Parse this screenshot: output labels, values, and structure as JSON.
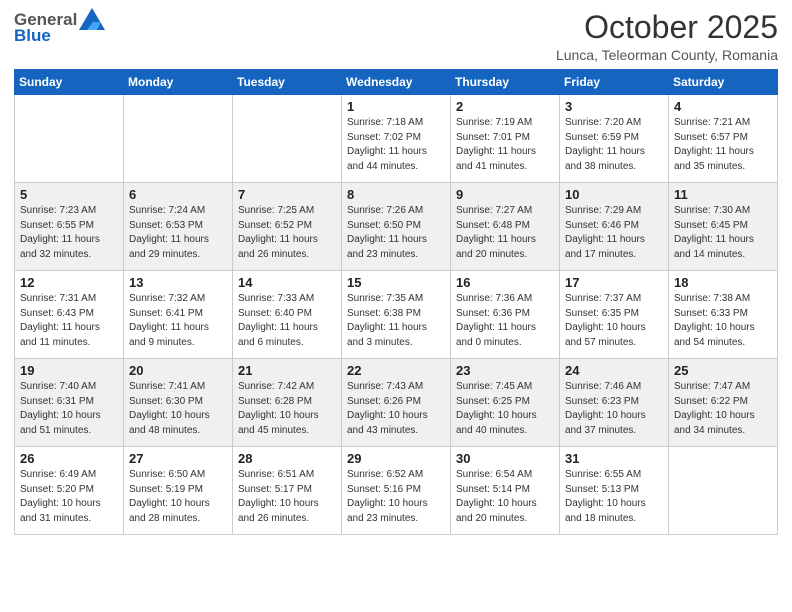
{
  "header": {
    "logo_general": "General",
    "logo_blue": "Blue",
    "month_title": "October 2025",
    "location": "Lunca, Teleorman County, Romania"
  },
  "days_of_week": [
    "Sunday",
    "Monday",
    "Tuesday",
    "Wednesday",
    "Thursday",
    "Friday",
    "Saturday"
  ],
  "weeks": [
    [
      {
        "day": "",
        "info": ""
      },
      {
        "day": "",
        "info": ""
      },
      {
        "day": "",
        "info": ""
      },
      {
        "day": "1",
        "info": "Sunrise: 7:18 AM\nSunset: 7:02 PM\nDaylight: 11 hours\nand 44 minutes."
      },
      {
        "day": "2",
        "info": "Sunrise: 7:19 AM\nSunset: 7:01 PM\nDaylight: 11 hours\nand 41 minutes."
      },
      {
        "day": "3",
        "info": "Sunrise: 7:20 AM\nSunset: 6:59 PM\nDaylight: 11 hours\nand 38 minutes."
      },
      {
        "day": "4",
        "info": "Sunrise: 7:21 AM\nSunset: 6:57 PM\nDaylight: 11 hours\nand 35 minutes."
      }
    ],
    [
      {
        "day": "5",
        "info": "Sunrise: 7:23 AM\nSunset: 6:55 PM\nDaylight: 11 hours\nand 32 minutes."
      },
      {
        "day": "6",
        "info": "Sunrise: 7:24 AM\nSunset: 6:53 PM\nDaylight: 11 hours\nand 29 minutes."
      },
      {
        "day": "7",
        "info": "Sunrise: 7:25 AM\nSunset: 6:52 PM\nDaylight: 11 hours\nand 26 minutes."
      },
      {
        "day": "8",
        "info": "Sunrise: 7:26 AM\nSunset: 6:50 PM\nDaylight: 11 hours\nand 23 minutes."
      },
      {
        "day": "9",
        "info": "Sunrise: 7:27 AM\nSunset: 6:48 PM\nDaylight: 11 hours\nand 20 minutes."
      },
      {
        "day": "10",
        "info": "Sunrise: 7:29 AM\nSunset: 6:46 PM\nDaylight: 11 hours\nand 17 minutes."
      },
      {
        "day": "11",
        "info": "Sunrise: 7:30 AM\nSunset: 6:45 PM\nDaylight: 11 hours\nand 14 minutes."
      }
    ],
    [
      {
        "day": "12",
        "info": "Sunrise: 7:31 AM\nSunset: 6:43 PM\nDaylight: 11 hours\nand 11 minutes."
      },
      {
        "day": "13",
        "info": "Sunrise: 7:32 AM\nSunset: 6:41 PM\nDaylight: 11 hours\nand 9 minutes."
      },
      {
        "day": "14",
        "info": "Sunrise: 7:33 AM\nSunset: 6:40 PM\nDaylight: 11 hours\nand 6 minutes."
      },
      {
        "day": "15",
        "info": "Sunrise: 7:35 AM\nSunset: 6:38 PM\nDaylight: 11 hours\nand 3 minutes."
      },
      {
        "day": "16",
        "info": "Sunrise: 7:36 AM\nSunset: 6:36 PM\nDaylight: 11 hours\nand 0 minutes."
      },
      {
        "day": "17",
        "info": "Sunrise: 7:37 AM\nSunset: 6:35 PM\nDaylight: 10 hours\nand 57 minutes."
      },
      {
        "day": "18",
        "info": "Sunrise: 7:38 AM\nSunset: 6:33 PM\nDaylight: 10 hours\nand 54 minutes."
      }
    ],
    [
      {
        "day": "19",
        "info": "Sunrise: 7:40 AM\nSunset: 6:31 PM\nDaylight: 10 hours\nand 51 minutes."
      },
      {
        "day": "20",
        "info": "Sunrise: 7:41 AM\nSunset: 6:30 PM\nDaylight: 10 hours\nand 48 minutes."
      },
      {
        "day": "21",
        "info": "Sunrise: 7:42 AM\nSunset: 6:28 PM\nDaylight: 10 hours\nand 45 minutes."
      },
      {
        "day": "22",
        "info": "Sunrise: 7:43 AM\nSunset: 6:26 PM\nDaylight: 10 hours\nand 43 minutes."
      },
      {
        "day": "23",
        "info": "Sunrise: 7:45 AM\nSunset: 6:25 PM\nDaylight: 10 hours\nand 40 minutes."
      },
      {
        "day": "24",
        "info": "Sunrise: 7:46 AM\nSunset: 6:23 PM\nDaylight: 10 hours\nand 37 minutes."
      },
      {
        "day": "25",
        "info": "Sunrise: 7:47 AM\nSunset: 6:22 PM\nDaylight: 10 hours\nand 34 minutes."
      }
    ],
    [
      {
        "day": "26",
        "info": "Sunrise: 6:49 AM\nSunset: 5:20 PM\nDaylight: 10 hours\nand 31 minutes."
      },
      {
        "day": "27",
        "info": "Sunrise: 6:50 AM\nSunset: 5:19 PM\nDaylight: 10 hours\nand 28 minutes."
      },
      {
        "day": "28",
        "info": "Sunrise: 6:51 AM\nSunset: 5:17 PM\nDaylight: 10 hours\nand 26 minutes."
      },
      {
        "day": "29",
        "info": "Sunrise: 6:52 AM\nSunset: 5:16 PM\nDaylight: 10 hours\nand 23 minutes."
      },
      {
        "day": "30",
        "info": "Sunrise: 6:54 AM\nSunset: 5:14 PM\nDaylight: 10 hours\nand 20 minutes."
      },
      {
        "day": "31",
        "info": "Sunrise: 6:55 AM\nSunset: 5:13 PM\nDaylight: 10 hours\nand 18 minutes."
      },
      {
        "day": "",
        "info": ""
      }
    ]
  ]
}
